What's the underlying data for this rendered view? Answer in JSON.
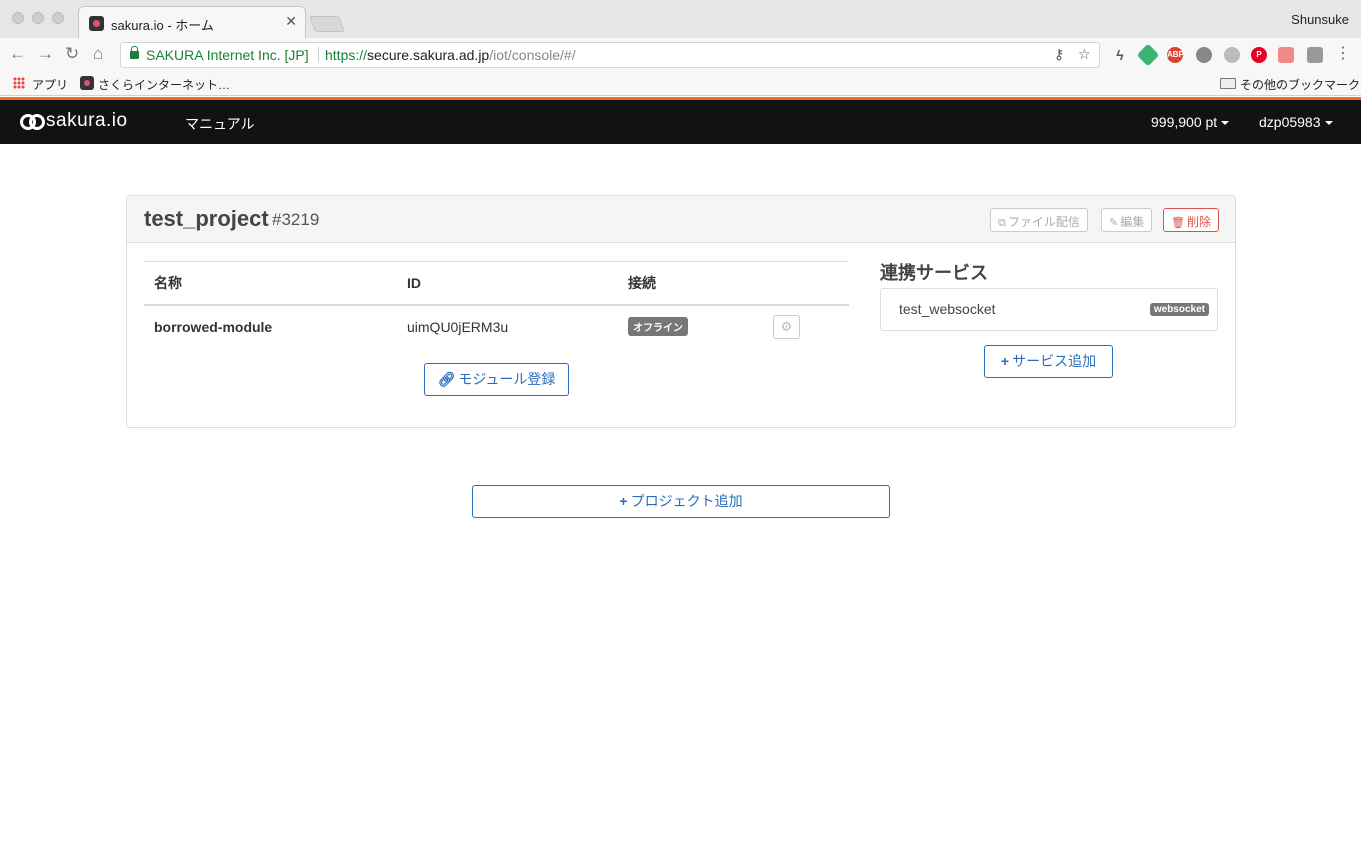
{
  "browser": {
    "tab_title": "sakura.io - ホーム",
    "profile_name": "Shunsuke",
    "ev_label": "SAKURA Internet Inc. [JP]",
    "url_scheme": "https://",
    "url_host": "secure.sakura.ad.jp",
    "url_path": "/iot/console/#/",
    "bookmarks": {
      "apps": "アプリ",
      "sakura": "さくらインターネット…",
      "other": "その他のブックマーク"
    }
  },
  "navbar": {
    "logo_text": "sakura.io",
    "manual_link": "マニュアル",
    "points": "999,900 pt",
    "user": "dzp05983",
    "accent_color": "#f0672a"
  },
  "project": {
    "name": "test_project",
    "id": "#3219",
    "buttons": {
      "file_delivery": "ファイル配信",
      "edit": "編集",
      "delete": "削除"
    },
    "modules_table": {
      "headers": [
        "名称",
        "ID",
        "接続"
      ],
      "rows": [
        {
          "name": "borrowed-module",
          "id": "uimQU0jERM3u",
          "status": "オフライン"
        }
      ]
    },
    "register_module_button": "モジュール登録",
    "services_title": "連携サービス",
    "services": [
      {
        "name": "test_websocket",
        "type": "websocket"
      }
    ],
    "add_service_button": "サービス追加"
  },
  "add_project_button": "プロジェクト追加",
  "colors": {
    "primary": "#2a6ebb",
    "danger": "#d9534f",
    "navbar_bg": "#121212"
  }
}
